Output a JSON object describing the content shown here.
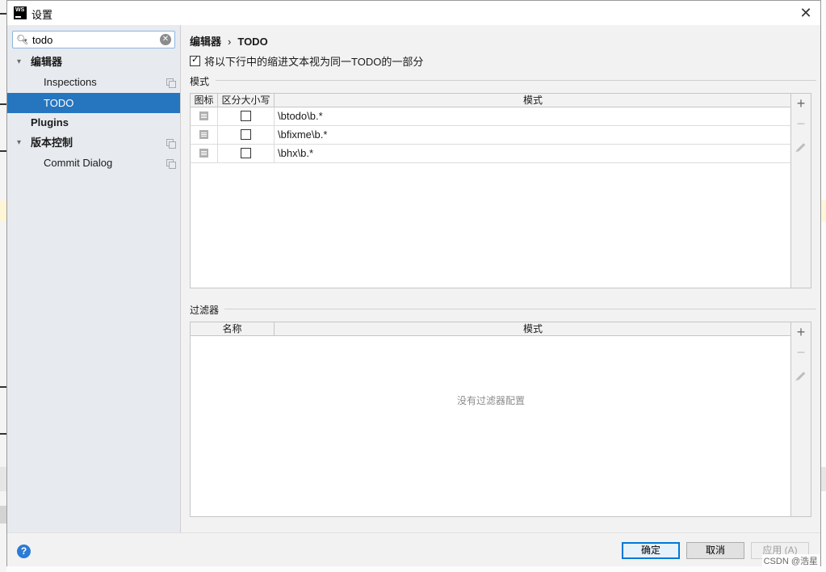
{
  "window": {
    "title": "设置",
    "app_icon": "WS"
  },
  "sidebar": {
    "search_value": "todo",
    "items": [
      {
        "label": "编辑器",
        "expanded": true
      },
      {
        "label": "Inspections"
      },
      {
        "label": "TODO",
        "selected": true
      },
      {
        "label": "Plugins"
      },
      {
        "label": "版本控制",
        "expanded": true
      },
      {
        "label": "Commit Dialog"
      }
    ]
  },
  "main": {
    "breadcrumb": {
      "parent": "编辑器",
      "sep": "›",
      "current": "TODO"
    },
    "multiline_checkbox": {
      "label": "将以下行中的缩进文本视为同一TODO的一部分",
      "checked": true
    },
    "patterns": {
      "section_title": "模式",
      "columns": [
        "图标",
        "区分大小写",
        "模式"
      ],
      "rows": [
        {
          "case_sensitive": false,
          "pattern": "\\btodo\\b.*"
        },
        {
          "case_sensitive": false,
          "pattern": "\\bfixme\\b.*"
        },
        {
          "case_sensitive": false,
          "pattern": "\\bhx\\b.*"
        }
      ],
      "toolbar": [
        "add-icon",
        "remove-icon",
        "edit-icon"
      ]
    },
    "filters": {
      "section_title": "过滤器",
      "columns": [
        "名称",
        "模式"
      ],
      "empty_text": "没有过滤器配置",
      "toolbar": [
        "add-icon",
        "remove-icon",
        "edit-icon"
      ]
    }
  },
  "footer": {
    "help": "?",
    "ok": "确定",
    "cancel": "取消",
    "apply": "应用 (A)"
  },
  "watermark": "CSDN @浩星",
  "colors": {
    "selection": "#2675bf",
    "sidebar_bg": "#e7ebf0",
    "dialog_bg": "#f2f2f2",
    "help_blue": "#2b7bd6"
  }
}
